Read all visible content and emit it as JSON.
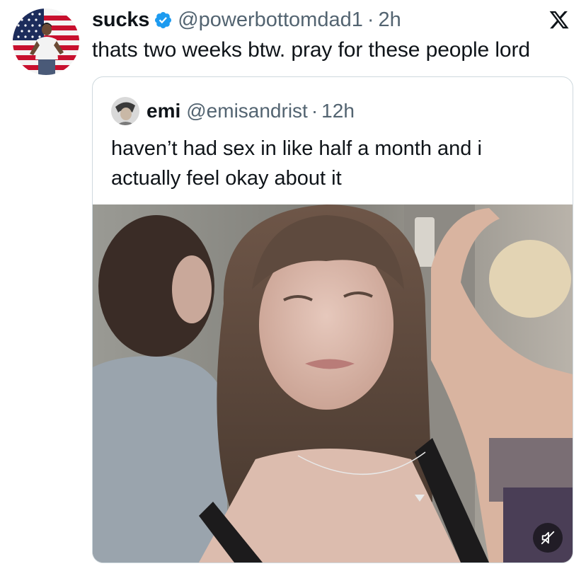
{
  "post": {
    "display_name": "sucks",
    "handle": "@powerbottomdad1",
    "separator": "·",
    "time": "2h",
    "text": "thats two weeks btw. pray for these people lord",
    "verified": true
  },
  "quoted": {
    "display_name": "emi",
    "handle": "@emisandrist",
    "separator": "·",
    "time": "12h",
    "text_lines": [
      "haven’t had sex in like half a month and i",
      "actually feel okay about it"
    ],
    "media": {
      "kind": "video-thumbnail",
      "muted": true
    }
  },
  "icons": {
    "verified": "verified-badge-icon",
    "brand": "x-logo-icon",
    "mute": "speaker-muted-icon"
  },
  "colors": {
    "text": "#0f1419",
    "secondary": "#536471",
    "verified": "#1d9bf0",
    "border": "#cfd9de"
  }
}
